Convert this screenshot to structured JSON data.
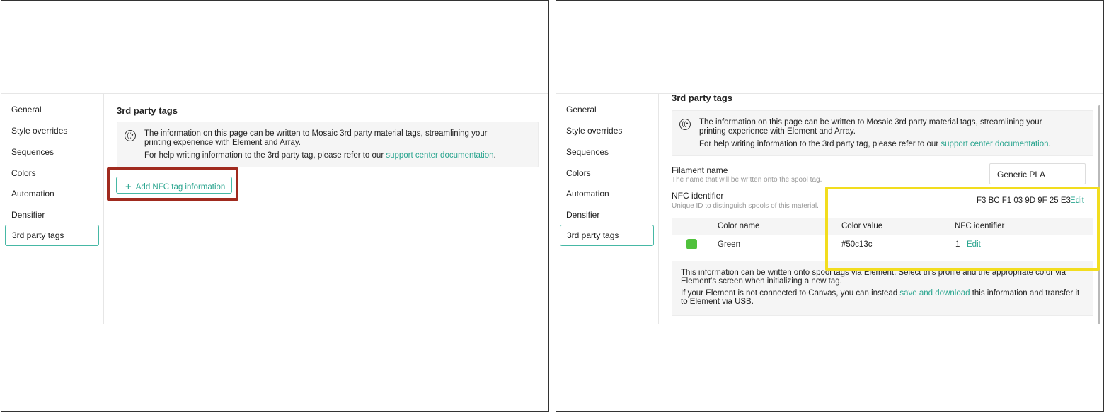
{
  "sidebar": {
    "items": [
      {
        "label": "General"
      },
      {
        "label": "Style overrides"
      },
      {
        "label": "Sequences"
      },
      {
        "label": "Colors"
      },
      {
        "label": "Automation"
      },
      {
        "label": "Densifier"
      },
      {
        "label": "3rd party tags"
      }
    ],
    "active": "3rd party tags"
  },
  "section_title": "3rd party tags",
  "info": {
    "line1": "The information on this page can be written to Mosaic 3rd party material tags, streamlining your printing experience with Element and Array.",
    "line2_prefix": "For help writing information to the 3rd party tag, please refer to our ",
    "link": "support center documentation",
    "line2_suffix": "."
  },
  "add_button": {
    "label": "Add NFC tag information"
  },
  "filament": {
    "label": "Filament name",
    "description": "The name that will be written onto the spool tag.",
    "value": "Generic PLA"
  },
  "nfc": {
    "label": "NFC identifier",
    "description": "Unique ID to distinguish spools of this material.",
    "value": "F3 BC F1 03 9D 9F 25 E3",
    "edit_label": "Edit"
  },
  "table": {
    "headers": [
      "Color name",
      "Color value",
      "NFC identifier"
    ],
    "rows": [
      {
        "color_name": "Green",
        "color_value": "#50c13c",
        "nfc_id": "1",
        "edit_label": "Edit",
        "swatch": "#50c13c"
      }
    ]
  },
  "bottom_info": {
    "line1": "This information can be written onto spool tags via Element. Select this profile and the appropriate color via Element's screen when initializing a new tag.",
    "line2_prefix": "If your Element is not connected to Canvas, you can instead ",
    "link": "save and download",
    "line2_suffix": " this information and transfer it to Element via USB."
  },
  "colors": {
    "accent": "#2aa58f",
    "highlight_red": "#a02a1e",
    "highlight_yellow": "#f2dd1e"
  }
}
